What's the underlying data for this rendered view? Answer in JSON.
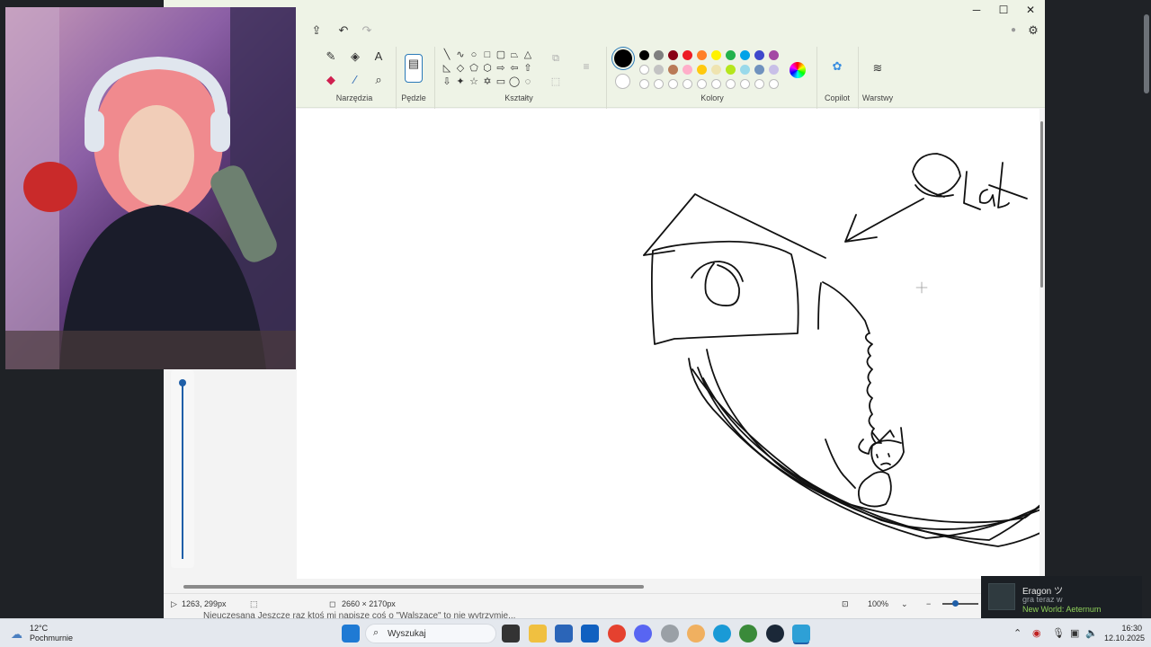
{
  "ribbon": {
    "groups": {
      "tools": "Narzędzia",
      "brushes": "Pędzle",
      "shapes": "Kształty",
      "colors": "Kolory",
      "copilot": "Copilot",
      "layers": "Warstwy"
    },
    "colors": {
      "active": "#000000",
      "row1": [
        "#000000",
        "#7f7f7f",
        "#880015",
        "#ed1c24",
        "#ff7f27",
        "#fff200",
        "#22b14c",
        "#00a2e8",
        "#3f48cc",
        "#a349a4"
      ],
      "row2": [
        "#ffffff",
        "#c3c3c3",
        "#b97a57",
        "#ffaec9",
        "#ffc90e",
        "#efe4b0",
        "#b5e61d",
        "#99d9ea",
        "#7092be",
        "#c8bfe7"
      ]
    }
  },
  "canvas": {
    "handwritten_text": "9 Lat"
  },
  "status": {
    "cursor_pos": "1263, 299px",
    "canvas_size": "2660 × 2170px",
    "zoom": "100%"
  },
  "chat": {
    "text": "Nieuczesana  Jeszcze raz ktoś mi napisze coś o \"Walszace\" to nie wytrzymie..."
  },
  "notification": {
    "name": "Eragon ツ",
    "status": "gra teraz w",
    "game": "New World: Aeternum"
  },
  "taskbar": {
    "weather_temp": "12°C",
    "weather_desc": "Pochmurnie",
    "search_placeholder": "Wyszukaj",
    "time": "16:30",
    "date": "12.10.2025"
  }
}
